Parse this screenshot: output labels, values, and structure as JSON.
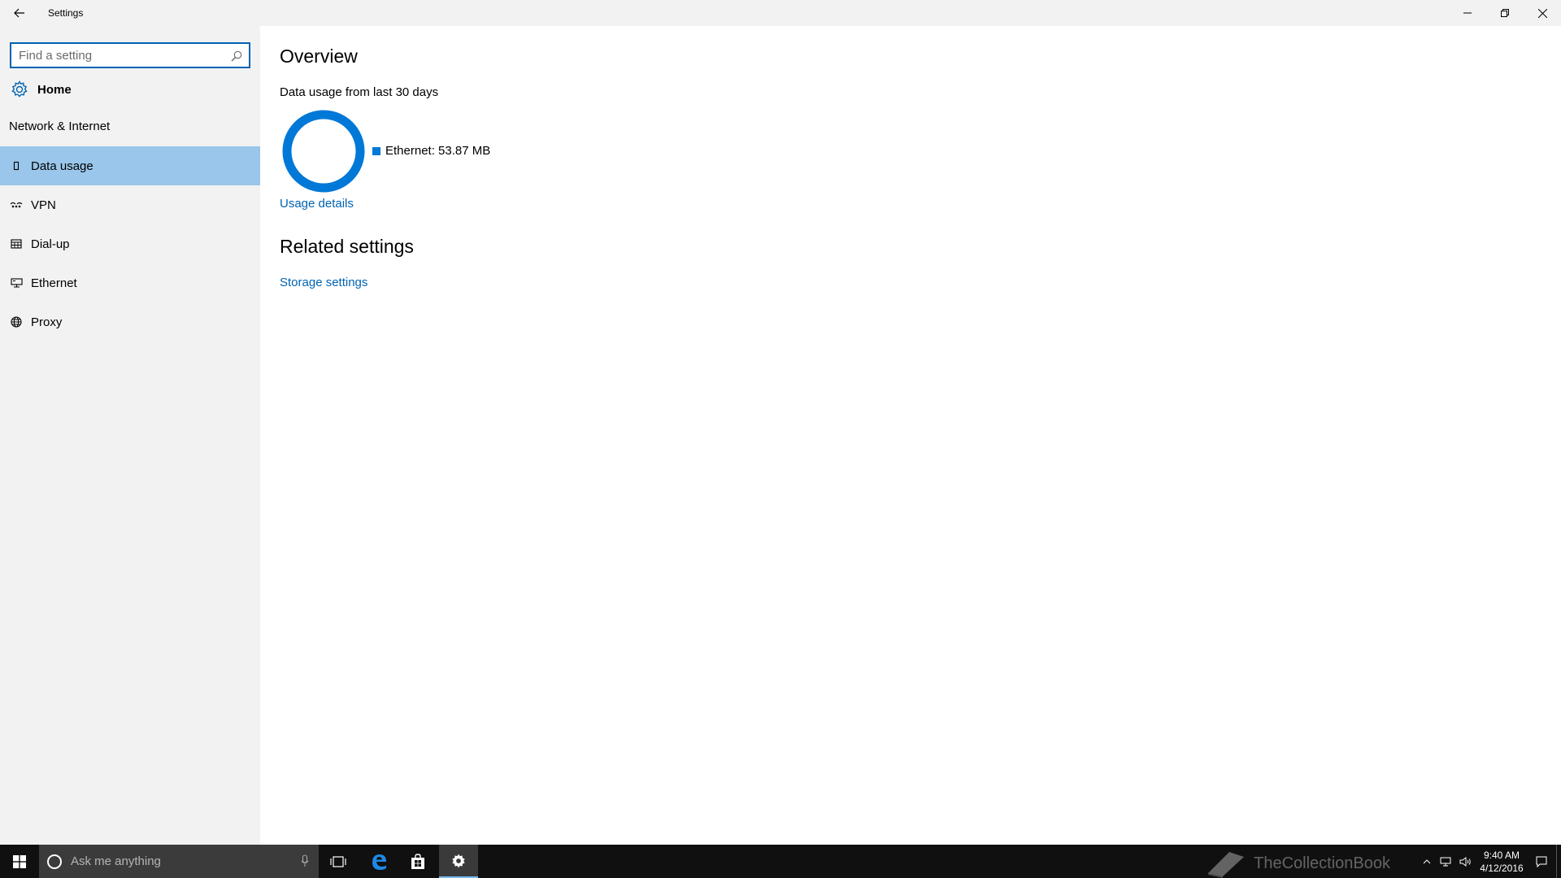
{
  "window": {
    "title": "Settings"
  },
  "sidebar": {
    "search_placeholder": "Find a setting",
    "home_label": "Home",
    "section_title": "Network & Internet",
    "items": [
      {
        "label": "Data usage",
        "icon": "data-usage-icon",
        "selected": true
      },
      {
        "label": "VPN",
        "icon": "vpn-icon",
        "selected": false
      },
      {
        "label": "Dial-up",
        "icon": "dial-up-icon",
        "selected": false
      },
      {
        "label": "Ethernet",
        "icon": "ethernet-icon",
        "selected": false
      },
      {
        "label": "Proxy",
        "icon": "globe-icon",
        "selected": false
      }
    ]
  },
  "main": {
    "title": "Overview",
    "subtitle": "Data usage from last 30 days",
    "legend_label": "Ethernet: 53.87 MB",
    "usage_link": "Usage details",
    "related_title": "Related settings",
    "storage_link": "Storage settings"
  },
  "taskbar": {
    "search_placeholder": "Ask me anything",
    "time": "9:40 AM",
    "date": "4/12/2016",
    "watermark": "TheCollectionBook"
  },
  "colors": {
    "accent": "#0078d7",
    "selected_bg": "#99c6ea",
    "link": "#0063b1",
    "sidebar_bg": "#f2f2f2",
    "taskbar_bg": "#101010"
  }
}
